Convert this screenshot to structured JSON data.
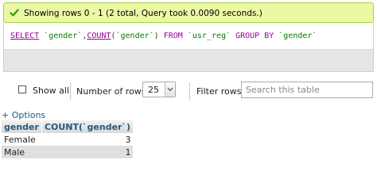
{
  "success": {
    "message": "Showing rows 0 - 1 (2 total, Query took 0.0090 seconds.)",
    "icon": "check-icon",
    "color": "#ebf8a4"
  },
  "sql": {
    "select": "SELECT",
    "t1": "`gender`",
    "comma": ",",
    "count": "COUNT",
    "lparen": "(",
    "t2": "`gender`",
    "rparen": ")",
    "from": "FROM",
    "table": "`usr_reg`",
    "group_by": "GROUP BY",
    "t3": "`gender`"
  },
  "controls": {
    "show_all_label": "Show all",
    "number_of_rows_label": "Number of rows:",
    "rows_value": "25",
    "filter_rows_label": "Filter rows:",
    "search_placeholder": "Search this table"
  },
  "options_link": "+ Options",
  "table": {
    "headers": [
      "gender",
      "COUNT(`gender`)"
    ],
    "rows": [
      [
        "Female",
        "3"
      ],
      [
        "Male",
        "1"
      ]
    ]
  }
}
